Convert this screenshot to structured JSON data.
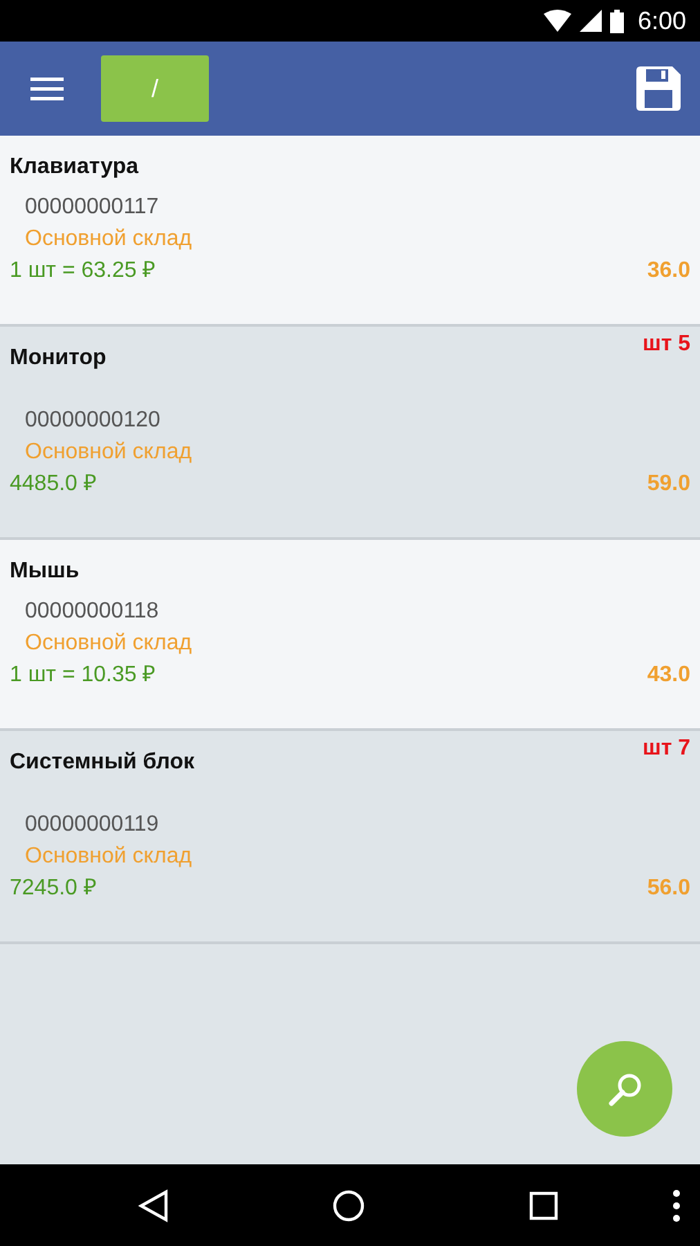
{
  "status_bar": {
    "time": "6:00"
  },
  "toolbar": {
    "path_button": "/"
  },
  "items": [
    {
      "name": "Клавиатура",
      "code": "00000000117",
      "warehouse": "Основной склад",
      "price": "1 шт = 63.25 ₽",
      "quantity": "36.0"
    },
    {
      "name": "Монитор",
      "badge": "шт 5",
      "code": "00000000120",
      "warehouse": "Основной склад",
      "price": "4485.0 ₽",
      "quantity": "59.0"
    },
    {
      "name": "Мышь",
      "code": "00000000118",
      "warehouse": "Основной склад",
      "price": "1 шт = 10.35 ₽",
      "quantity": "43.0"
    },
    {
      "name": "Системный блок",
      "badge": "шт 7",
      "code": "00000000119",
      "warehouse": "Основной склад",
      "price": "7245.0 ₽",
      "quantity": "56.0"
    }
  ]
}
